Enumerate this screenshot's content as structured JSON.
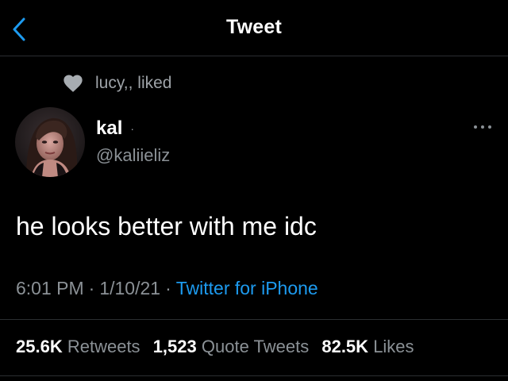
{
  "header": {
    "title": "Tweet",
    "back_icon": "chevron-left-icon",
    "accent_color": "#1d9bf0"
  },
  "social_context": {
    "icon": "heart-icon",
    "text": "lucy,, liked"
  },
  "author": {
    "display_name": "kal",
    "name_separator": "·",
    "username": "@kaliieliz"
  },
  "tweet": {
    "text": "he looks better with me idc",
    "time": "6:01 PM",
    "date": "1/10/21",
    "source": "Twitter for iPhone",
    "separator": "·"
  },
  "stats": {
    "retweets_count": "25.6K",
    "retweets_label": "Retweets",
    "quotes_count": "1,523",
    "quotes_label": "Quote Tweets",
    "likes_count": "82.5K",
    "likes_label": "Likes"
  }
}
